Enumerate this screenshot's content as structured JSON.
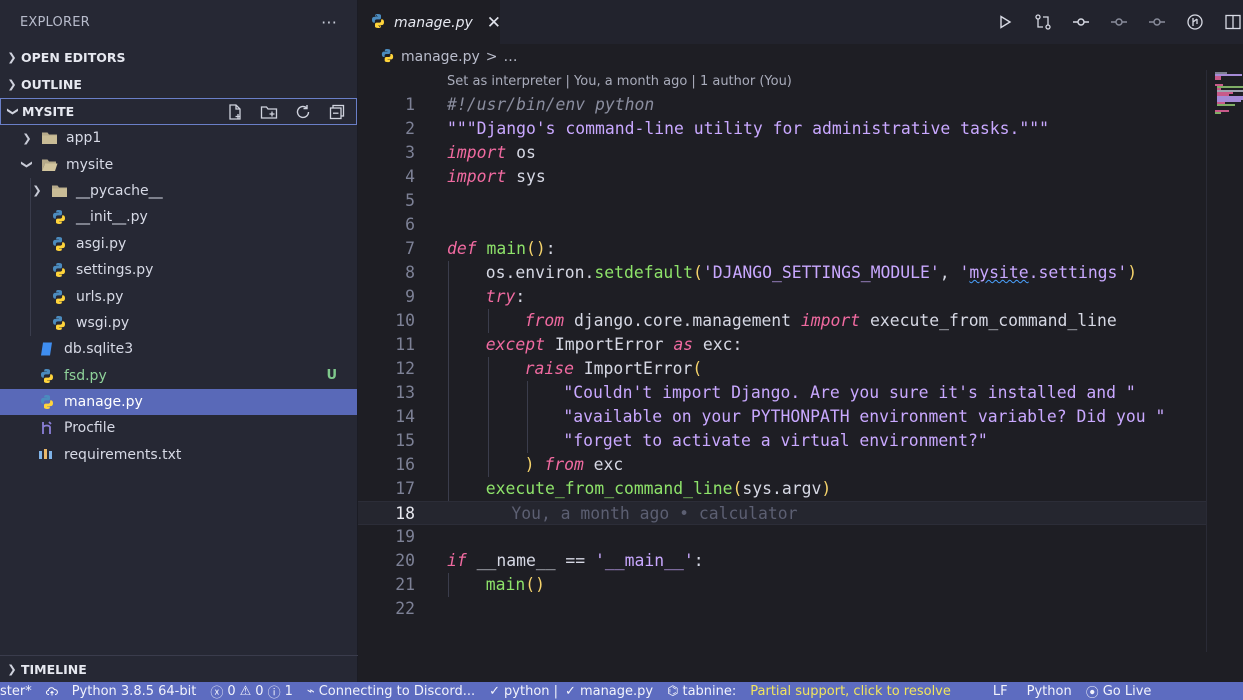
{
  "sidebar": {
    "title": "EXPLORER",
    "more": "···",
    "sections": {
      "open_editors": "OPEN EDITORS",
      "outline": "OUTLINE",
      "project": "MYSITE",
      "timeline": "TIMELINE"
    },
    "tree": [
      {
        "label": "app1",
        "type": "folder",
        "indent": 1,
        "expanded": false
      },
      {
        "label": "mysite",
        "type": "folder",
        "indent": 1,
        "expanded": true
      },
      {
        "label": "__pycache__",
        "type": "folder",
        "indent": 2,
        "expanded": false
      },
      {
        "label": "__init__.py",
        "type": "python",
        "indent": 2
      },
      {
        "label": "asgi.py",
        "type": "python",
        "indent": 2
      },
      {
        "label": "settings.py",
        "type": "python",
        "indent": 2
      },
      {
        "label": "urls.py",
        "type": "python",
        "indent": 2
      },
      {
        "label": "wsgi.py",
        "type": "python",
        "indent": 2
      },
      {
        "label": "db.sqlite3",
        "type": "database",
        "indent": 1
      },
      {
        "label": "fsd.py",
        "type": "python",
        "indent": 1,
        "badge": "U"
      },
      {
        "label": "manage.py",
        "type": "python",
        "indent": 1,
        "selected": true
      },
      {
        "label": "Procfile",
        "type": "procfile",
        "indent": 1
      },
      {
        "label": "requirements.txt",
        "type": "text",
        "indent": 1
      }
    ]
  },
  "tabs": [
    {
      "label": "manage.py",
      "active": true
    }
  ],
  "breadcrumb": {
    "file": "manage.py",
    "sep": ">",
    "rest": "…"
  },
  "editor": {
    "codelens": "Set as interpreter | You, a month ago | 1 author (You)",
    "current_line": 18,
    "blame": "You, a month ago • calculator",
    "line_numbers": [
      "1",
      "2",
      "3",
      "4",
      "5",
      "6",
      "7",
      "8",
      "9",
      "10",
      "11",
      "12",
      "13",
      "14",
      "15",
      "16",
      "17",
      "18",
      "19",
      "20",
      "21",
      "22"
    ],
    "lines": {
      "l1": "#!/usr/bin/env python",
      "l2": "\"\"\"Django's command-line utility for administrative tasks.\"\"\"",
      "l3_kw": "import",
      "l3_rest": " os",
      "l4_kw": "import",
      "l4_rest": " sys",
      "l7_kw": "def",
      "l7_fn": "main",
      "l7_paren": "()",
      "l7_colon": ":",
      "l8_a": "os.environ.",
      "l8_fn": "setdefault",
      "l8_p1": "(",
      "l8_s1": "'DJANGO_SETTINGS_MODULE'",
      "l8_c": ", ",
      "l8_s2a": "'",
      "l8_s2b": "mysite",
      "l8_s2c": ".settings'",
      "l8_p2": ")",
      "l9_kw": "try",
      "l9_colon": ":",
      "l10_kw": "from",
      "l10_mid": " django.core.management ",
      "l10_kw2": "import",
      "l10_rest": " execute_from_command_line",
      "l11_kw": "except",
      "l11_mid": " ImportError ",
      "l11_kw2": "as",
      "l11_rest": " exc:",
      "l12_kw": "raise",
      "l12_mid": " ImportError",
      "l12_paren": "(",
      "l13": "\"Couldn't import Django. Are you sure it's installed and \"",
      "l14": "\"available on your PYTHONPATH environment variable? Did you \"",
      "l15": "\"forget to activate a virtual environment?\"",
      "l16_paren": ")",
      "l16_kw": " from",
      "l16_rest": " exc",
      "l17_fn": "execute_from_command_line",
      "l17_p1": "(",
      "l17_mid": "sys.argv",
      "l17_p2": ")",
      "l20_kw": "if",
      "l20_a": " __name__ == ",
      "l20_str": "'__main__'",
      "l20_colon": ":",
      "l21_fn": "main",
      "l21_paren": "()"
    }
  },
  "statusbar": {
    "branch": "ster*",
    "python": "Python 3.8.5 64-bit",
    "errors": "0",
    "warnings": "0",
    "info": "1",
    "discord": "Connecting to Discord...",
    "check1": "python |",
    "check2": "manage.py",
    "tabnine": "tabnine:",
    "partial": "Partial support, click to resolve",
    "eol": "LF",
    "language": "Python",
    "golive": "Go Live"
  },
  "colors": {
    "accent": "#5d6cc0",
    "selection": "#5969b8",
    "keyword": "#f06aa0",
    "function": "#8ee36a",
    "string": "#c9a8ff"
  }
}
